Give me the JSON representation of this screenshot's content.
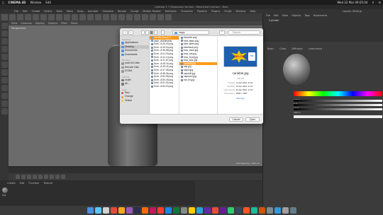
{
  "menubar": {
    "apple": "",
    "app": "CINEMA 4D",
    "items": [
      "Window",
      "Edit"
    ],
    "clock": "Wed 22 Mar 09:05:04"
  },
  "window_title": "Untitled 1 * (Classroom Version - Restricted License) - Main",
  "c4d_menu": [
    "File",
    "Edit",
    "Create",
    "Select",
    "Tools",
    "Mesh",
    "Snap",
    "Animate",
    "Simulate",
    "Render",
    "Sculpt",
    "Motion Tracker",
    "MoGraph",
    "Character",
    "Pipeline",
    "Plugins",
    "Script",
    "Window",
    "Help"
  ],
  "layout_label": "Layout:",
  "layout_value": "Startup",
  "viewport": {
    "menu": [
      "View",
      "Cameras",
      "Display",
      "Options",
      "Filter",
      "Panel"
    ],
    "label": "Perspective",
    "grid_info": "Grid Spacing : 100 cm"
  },
  "material_panel": {
    "menu": [
      "Create",
      "Edit",
      "Function",
      "Texture"
    ],
    "material_name": "Mat"
  },
  "object_panel": {
    "menu": [
      "File",
      "Edit",
      "View",
      "Objects",
      "Tags",
      "Bookmarks"
    ],
    "object_name": "Cylinder"
  },
  "attributes": {
    "tabs": [
      "Basic",
      "Color",
      "Diffusion",
      "Luminance"
    ],
    "values": [
      "100 %",
      "0 %",
      "67 %",
      "100 %"
    ]
  },
  "dialog": {
    "folder": "maps",
    "search_placeholder": "Search",
    "sidebar": {
      "favorites_label": "Favorites",
      "favorites": [
        "Applications",
        "Desktop",
        "Documents",
        "Downloads"
      ],
      "devices_label": "Devices",
      "devices": [
        "usbf-011-98m",
        "Remote Disc",
        "DCIMt"
      ],
      "shared_label": "Shared",
      "shared": [
        "usrjfh",
        "All..."
      ],
      "tags_label": "Tags",
      "tags": [
        {
          "name": "Red",
          "color": "#e5483d"
        },
        {
          "name": "Orange",
          "color": "#f49a2b"
        },
        {
          "name": "Yellow",
          "color": "#f2cd2a"
        }
      ]
    },
    "column1": {
      "items": [
        "c4d file lesson 3",
        "cash_oil4dlesetto",
        "Scre...8.26.03.png",
        "Scre...8.26.16.png",
        "Scre...8.36.58.png",
        "Scre...8.41.03.png",
        "Scre...8.41.13.png",
        "Scre...8.41.57.png",
        "Scre...8.45.34.png",
        "Scre...8.46.41.png",
        "Scre...8.47.08.png",
        "Scre...8.48.06.png",
        "Scre...8.50.08.png",
        "Scre...8.50.49.png",
        "Scre...8.51.32.png",
        "Scre...8.54.03.png"
      ],
      "selected_index": 0
    },
    "column2": {
      "items": [
        "barcode.png",
        "beer-table.png",
        "beer-label.png",
        "beerback.png",
        "bow_back.jpg",
        "bow_bot.jpg",
        "bow_front.jpg",
        "bow_side.jpg",
        "cariable.jpg",
        "cap.jpg",
        "capid.jpg",
        "capchill.jpg",
        "capnesn.jpg",
        "hot_fix.jpg"
      ],
      "selected_index": 8
    },
    "preview": {
      "thumb_text": "DELCH!",
      "badge_text": "750",
      "name": "cariable.jpg",
      "size": "702 KB",
      "meta": [
        {
          "key": "Created",
          "value": "13 Apr 2016, 21:47"
        },
        {
          "key": "Modified",
          "value": "13 Apr 2016, 21:47"
        },
        {
          "key": "Last opened",
          "value": "13 Apr 2016, 21:47"
        },
        {
          "key": "Dimensions",
          "value": "2500 × 1567"
        }
      ],
      "add_tags": "Add Tags..."
    },
    "buttons": {
      "cancel": "Cancel",
      "open": "Open"
    }
  },
  "dock_colors": [
    "#4a90e2",
    "#5ac8fa",
    "#d0d0d0",
    "#e24a3b",
    "#f5a623",
    "#9b59b6",
    "#2c2c54",
    "#ff6a00",
    "#c2185b",
    "#ff3b30",
    "#1e88e5",
    "#0b7a3b",
    "#888888",
    "#ffcc00",
    "#2aa5d8",
    "#5e2ca5",
    "#e74c3c",
    "#6a1b9a",
    "#2ecc71",
    "#34495e",
    "#ff5722",
    "#1abc9c",
    "#d35400",
    "#7f8c8d",
    "#3498db",
    "#9e9e9e",
    "#607d8b"
  ]
}
